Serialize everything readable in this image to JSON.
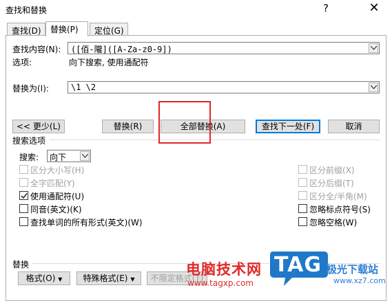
{
  "window": {
    "title": "查找和替换",
    "help": "?",
    "close": "✕"
  },
  "tabs": [
    {
      "label": "查找(D)"
    },
    {
      "label": "替换(P)"
    },
    {
      "label": "定位(G)"
    }
  ],
  "find": {
    "label": "查找内容(N):",
    "value": "([佰-隴]([A-Za-z0-9])",
    "options_label": "选项:",
    "options_value": "向下搜索, 使用通配符"
  },
  "replace": {
    "label": "替换为(I):",
    "value": "\\1 \\2"
  },
  "buttons": {
    "less": "<< 更少(L)",
    "replace": "替换(R)",
    "replace_all": "全部替换(A)",
    "find_next": "查找下一处(F)",
    "cancel": "取消"
  },
  "search_options": {
    "group_title": "搜索选项",
    "search_label": "搜索:",
    "search_value": "向下",
    "left_checks": [
      {
        "label": "区分大小写(H)",
        "checked": false,
        "disabled": true
      },
      {
        "label": "全字匹配(Y)",
        "checked": false,
        "disabled": true
      },
      {
        "label": "使用通配符(U)",
        "checked": true,
        "disabled": false
      },
      {
        "label": "同音(英文)(K)",
        "checked": false,
        "disabled": false
      },
      {
        "label": "查找单词的所有形式(英文)(W)",
        "checked": false,
        "disabled": false
      }
    ],
    "right_checks": [
      {
        "label": "区分前缀(X)",
        "checked": false,
        "disabled": true
      },
      {
        "label": "区分后缀(T)",
        "checked": false,
        "disabled": true
      },
      {
        "label": "区分全/半角(M)",
        "checked": false,
        "disabled": true
      },
      {
        "label": "忽略标点符号(S)",
        "checked": false,
        "disabled": false
      },
      {
        "label": "忽略空格(W)",
        "checked": false,
        "disabled": false
      }
    ]
  },
  "replace_section": {
    "group_title": "替换",
    "format_btn": "格式(O)",
    "special_btn": "特殊格式(E)",
    "no_format_btn": "不限定格式(T)"
  },
  "watermark": {
    "brand": "电脑技术网",
    "url": "www.tagxp.com",
    "logo": "TAG",
    "site": "极光下载站",
    "site_url": "www.xz7.com"
  }
}
